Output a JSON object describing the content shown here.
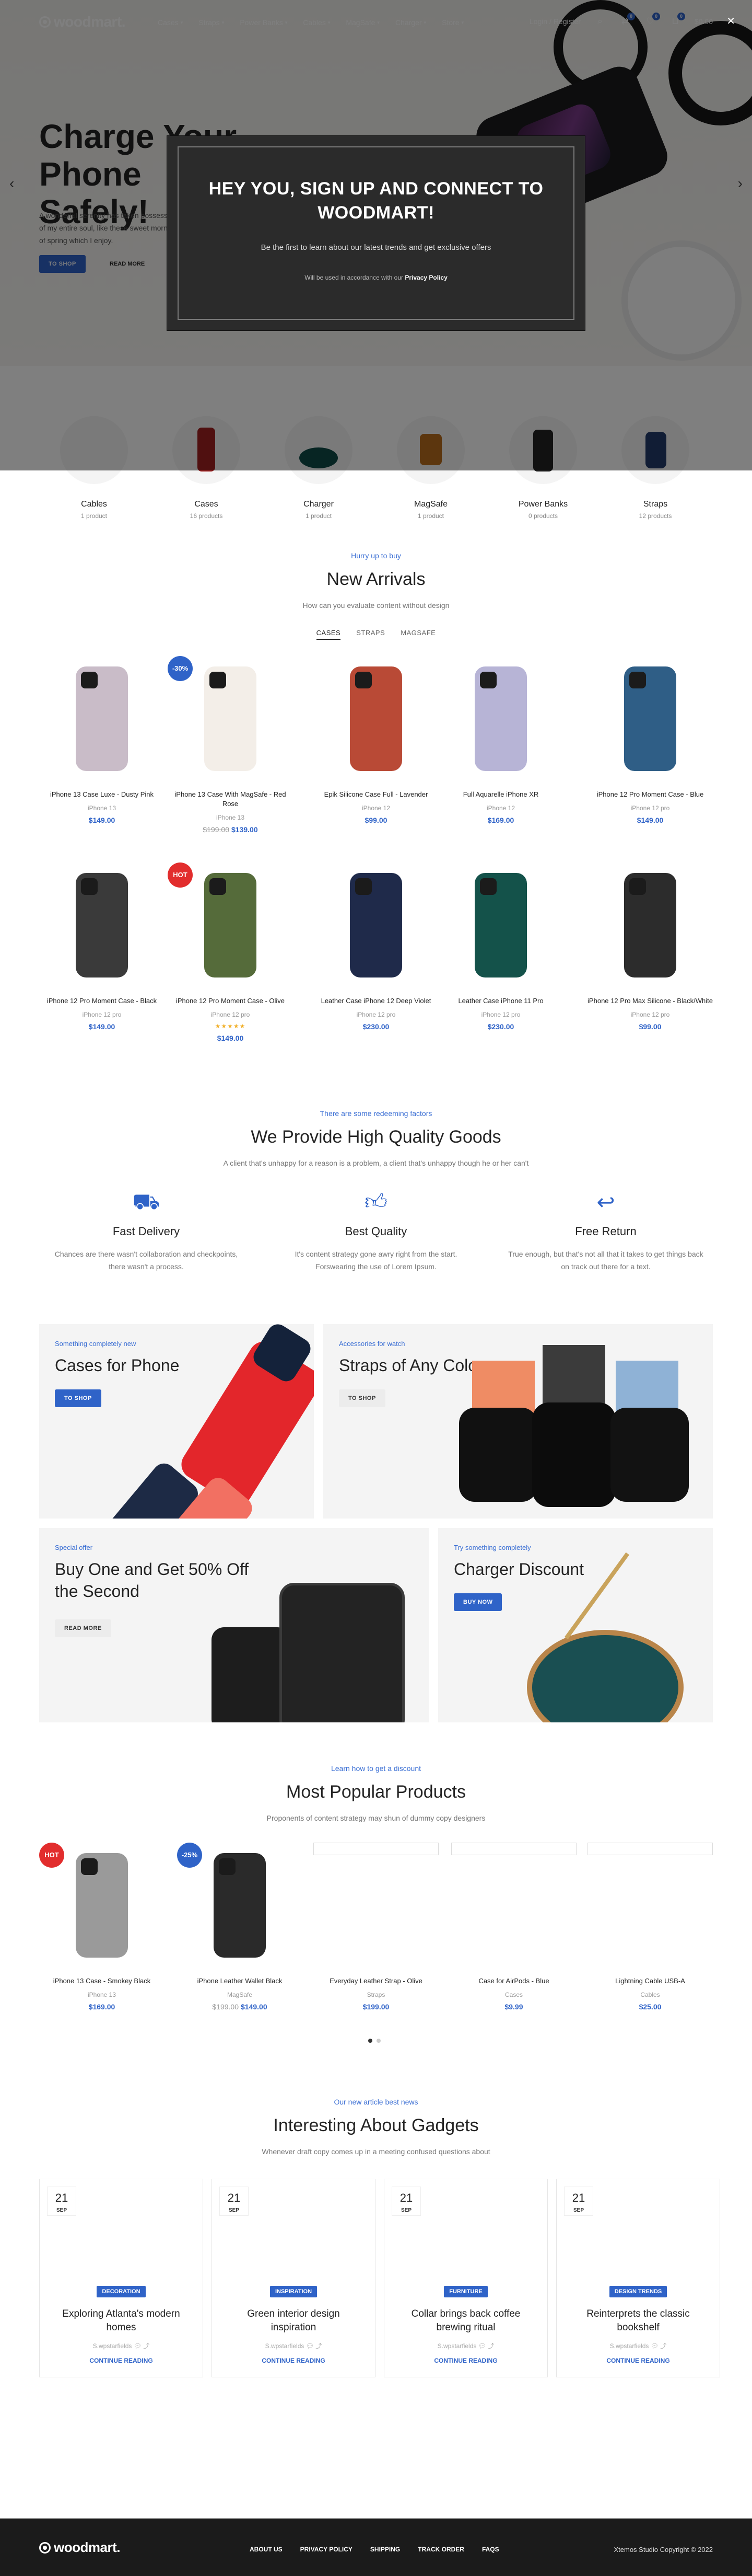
{
  "header": {
    "logo": "woodmart.",
    "nav": [
      {
        "label": "Cases",
        "dropdown": true
      },
      {
        "label": "Straps",
        "dropdown": true
      },
      {
        "label": "Power Banks",
        "dropdown": true
      },
      {
        "label": "Cables",
        "dropdown": true
      },
      {
        "label": "MagSafe",
        "dropdown": true
      },
      {
        "label": "Charger",
        "dropdown": true
      },
      {
        "label": "Store",
        "dropdown": true
      }
    ],
    "login": "Login / Register",
    "compare_count": "0",
    "wishlist_count": "0",
    "cart_count": "0",
    "cart_total": "$0.00"
  },
  "hero": {
    "title": "Charge Your Phone Safely!",
    "text": "A wonderful serenity has taken possession of my entire soul, like these sweet mornings of spring which I enjoy.",
    "button_primary": "TO SHOP",
    "button_secondary": "READ MORE"
  },
  "modal": {
    "title": "HEY YOU, SIGN UP AND CONNECT TO WOODMART!",
    "text": "Be the first to learn about our latest trends and get exclusive offers",
    "note_prefix": "Will be used in accordance with our",
    "note_link": "Privacy Policy"
  },
  "categories": [
    {
      "name": "Cables",
      "count": "1 product"
    },
    {
      "name": "Cases",
      "count": "16 products"
    },
    {
      "name": "Charger",
      "count": "1 product"
    },
    {
      "name": "MagSafe",
      "count": "1 product"
    },
    {
      "name": "Power Banks",
      "count": "0 products"
    },
    {
      "name": "Straps",
      "count": "12 products"
    }
  ],
  "new_arrivals": {
    "subtitle": "Hurry up to buy",
    "title": "New Arrivals",
    "description": "How can you evaluate content without design",
    "tabs": [
      "CASES",
      "STRAPS",
      "MAGSAFE"
    ],
    "products": [
      {
        "name": "iPhone 13 Case Luxe - Dusty Pink",
        "category": "iPhone 13",
        "price": "$149.00",
        "old_price": "",
        "badge": "",
        "color": "#c9bcc8"
      },
      {
        "name": "iPhone 13 Case With MagSafe - Red Rose",
        "category": "iPhone 13",
        "price": "$139.00",
        "old_price": "$199.00",
        "badge": "-30%",
        "color": "#f3eee8"
      },
      {
        "name": "Epik Silicone Case Full - Lavender",
        "category": "iPhone 12",
        "price": "$99.00",
        "old_price": "",
        "badge": "",
        "color": "#b94a36"
      },
      {
        "name": "Full Aquarelle iPhone XR",
        "category": "iPhone 12",
        "price": "$169.00",
        "old_price": "",
        "badge": "",
        "color": "#b7b4d6"
      },
      {
        "name": "iPhone 12 Pro Moment Case - Blue",
        "category": "iPhone 12 pro",
        "price": "$149.00",
        "old_price": "",
        "badge": "",
        "color": "#2f5e86"
      },
      {
        "name": "iPhone 12 Pro Moment Case - Black",
        "category": "iPhone 12 pro",
        "price": "$149.00",
        "old_price": "",
        "badge": "",
        "color": "#3a3a3a"
      },
      {
        "name": "iPhone 12 Pro Moment Case - Olive",
        "category": "iPhone 12 pro",
        "price": "$149.00",
        "old_price": "",
        "badge": "HOT",
        "color": "#556b3a",
        "stars": "★★★★★"
      },
      {
        "name": "Leather Case iPhone 12 Deep Violet",
        "category": "iPhone 12 pro",
        "price": "$230.00",
        "old_price": "",
        "badge": "",
        "color": "#1f2a4a"
      },
      {
        "name": "Leather Case iPhone 11 Pro",
        "category": "iPhone 12 pro",
        "price": "$230.00",
        "old_price": "",
        "badge": "",
        "color": "#14524a"
      },
      {
        "name": "iPhone 12 Pro Max Silicone - Black/White",
        "category": "iPhone 12 pro",
        "price": "$99.00",
        "old_price": "",
        "badge": "",
        "color": "#2c2c2c"
      }
    ]
  },
  "quality": {
    "subtitle": "There are some redeeming factors",
    "title": "We Provide High Quality Goods",
    "description": "A client that's unhappy for a reason is a problem, a client that's unhappy though he or her can't",
    "features": [
      {
        "icon": "truck-icon",
        "title": "Fast Delivery",
        "text": "Chances are there wasn't collaboration and checkpoints, there wasn't a process."
      },
      {
        "icon": "thumbs-up-icon",
        "title": "Best Quality",
        "text": "It's content strategy gone awry right from the start. Forswearing the use of Lorem Ipsum."
      },
      {
        "icon": "return-icon",
        "title": "Free Return",
        "text": "True enough, but that's not all that it takes to get things back on track out there for a text."
      }
    ]
  },
  "banners": [
    {
      "subtitle": "Something completely new",
      "title": "Cases for Phone",
      "button": "TO SHOP"
    },
    {
      "subtitle": "Accessories for watch",
      "title": "Straps of Any Color",
      "button": "TO SHOP"
    },
    {
      "subtitle": "Special offer",
      "title": "Buy One and Get 50% Off the Second",
      "button": "READ MORE"
    },
    {
      "subtitle": "Try something completely",
      "title": "Charger Discount",
      "button": "BUY NOW"
    }
  ],
  "popular": {
    "subtitle": "Learn how to get a discount",
    "title": "Most Popular Products",
    "description": "Proponents of content strategy may shun of dummy copy designers",
    "products": [
      {
        "name": "iPhone 13 Case - Smokey Black",
        "category": "iPhone 13",
        "price": "$169.00",
        "old_price": "",
        "badge": "HOT"
      },
      {
        "name": "iPhone Leather Wallet Black",
        "category": "MagSafe",
        "price": "$149.00",
        "old_price": "$199.00",
        "badge": "-25%"
      },
      {
        "name": "Everyday Leather Strap - Olive",
        "category": "Straps",
        "price": "$199.00",
        "old_price": "",
        "badge": ""
      },
      {
        "name": "Case for AirPods - Blue",
        "category": "Cases",
        "price": "$9.99",
        "old_price": "",
        "badge": ""
      },
      {
        "name": "Lightning Cable USB-A",
        "category": "Cables",
        "price": "$25.00",
        "old_price": "",
        "badge": ""
      }
    ]
  },
  "blog": {
    "subtitle": "Our new article best news",
    "title": "Interesting About Gadgets",
    "description": "Whenever draft copy comes up in a meeting confused questions about",
    "posts": [
      {
        "day": "21",
        "month": "SEP",
        "tag": "DECORATION",
        "title": "Exploring Atlanta's modern homes",
        "author": "S.wpstarfields",
        "more": "CONTINUE READING"
      },
      {
        "day": "21",
        "month": "SEP",
        "tag": "INSPIRATION",
        "title": "Green interior design inspiration",
        "author": "S.wpstarfields",
        "more": "CONTINUE READING"
      },
      {
        "day": "21",
        "month": "SEP",
        "tag": "FURNITURE",
        "title": "Collar brings back coffee brewing ritual",
        "author": "S.wpstarfields",
        "more": "CONTINUE READING"
      },
      {
        "day": "21",
        "month": "SEP",
        "tag": "DESIGN TRENDS",
        "title": "Reinterprets the classic bookshelf",
        "author": "S.wpstarfields",
        "more": "CONTINUE READING"
      }
    ]
  },
  "footer": {
    "logo": "woodmart.",
    "links": [
      "ABOUT US",
      "PRIVACY POLICY",
      "SHIPPING",
      "TRACK ORDER",
      "FAQS"
    ],
    "copyright": "Xtemos Studio Copyright © 2022"
  }
}
